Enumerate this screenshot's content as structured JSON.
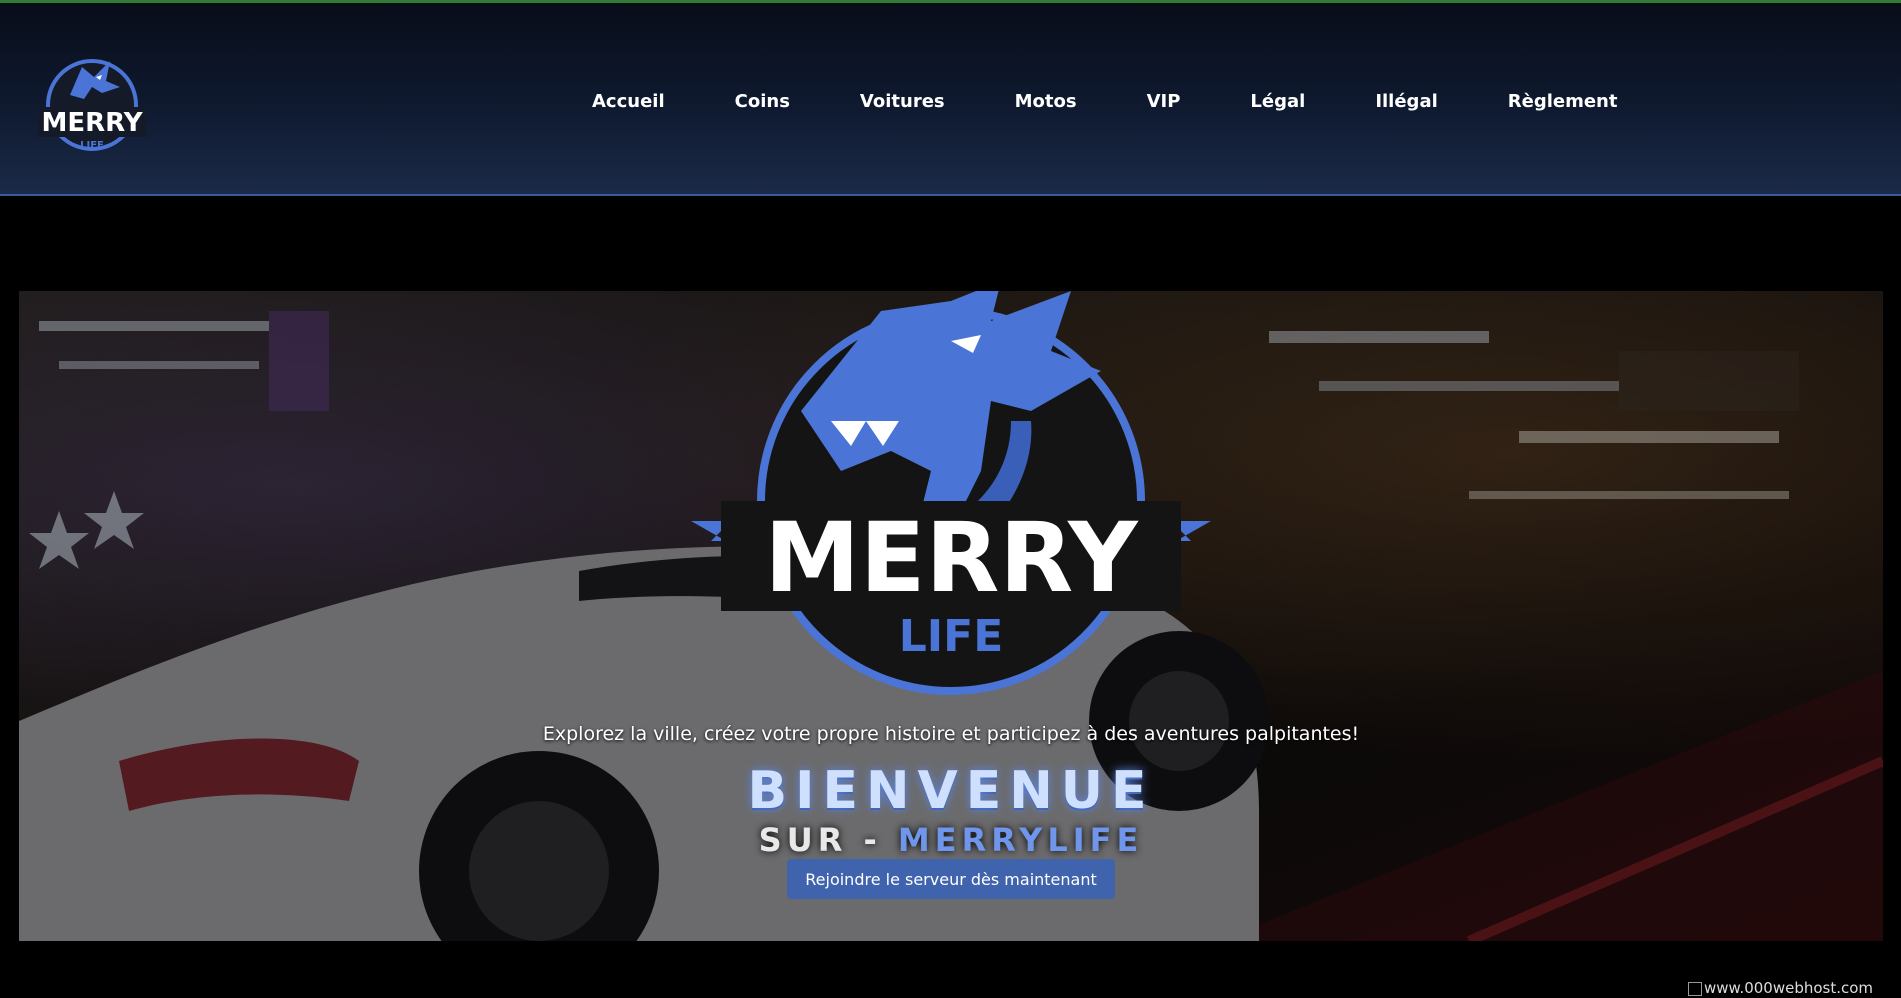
{
  "brand": {
    "logo_word": "MERRY",
    "logo_sub": "LIFE"
  },
  "nav": {
    "items": [
      {
        "label": "Accueil"
      },
      {
        "label": "Coins"
      },
      {
        "label": "Voitures"
      },
      {
        "label": "Motos"
      },
      {
        "label": "VIP"
      },
      {
        "label": "Légal"
      },
      {
        "label": "Illégal"
      },
      {
        "label": "Règlement"
      }
    ]
  },
  "hero": {
    "tagline": "Explorez la ville, créez votre propre histoire et participez à des aventures palpitantes!",
    "title_line1": "BIENVENUE",
    "title_sur": "SUR - ",
    "title_brand": "MERRYLIFE",
    "cta_label": "Rejoindre le serveur dès maintenant"
  },
  "footer": {
    "badge_alt": "www.000webhost.com"
  },
  "colors": {
    "accent": "#3f63ad",
    "logo_blue": "#4a74d6",
    "header_border": "#3c5a9a",
    "top_line": "#2e7d32"
  }
}
